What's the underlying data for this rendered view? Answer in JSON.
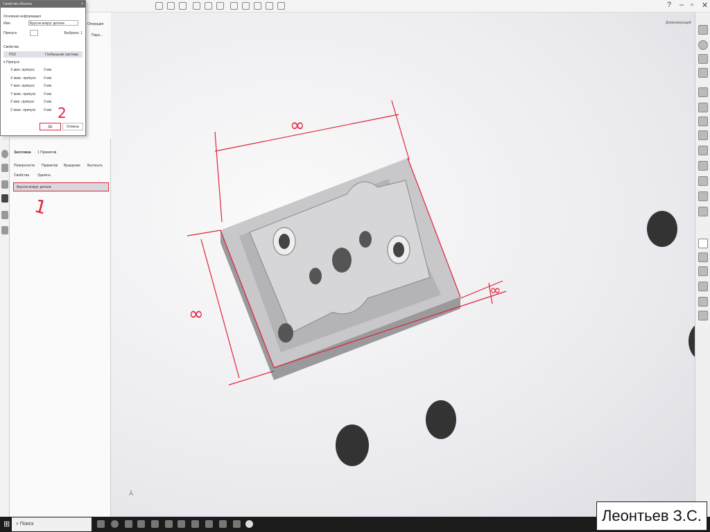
{
  "dialog": {
    "title": "Свойства объекта",
    "section_main": "Основная информация",
    "name_label": "Имя",
    "name_value": "Брусок вокруг детали",
    "allowance_label": "Припуск",
    "selected": "Выбрано: 1",
    "section_props": "Свойства",
    "csys_label": "ПСК",
    "csys_value": "Глобальная система",
    "allowance_group": "Припуск",
    "rows": [
      {
        "label": "X мин. припуск",
        "value": "0 мм"
      },
      {
        "label": "X макс. припуск",
        "value": "0 мм"
      },
      {
        "label": "Y мин. припуск",
        "value": "0 мм"
      },
      {
        "label": "Y макс. припуск",
        "value": "0 мм"
      },
      {
        "label": "Z мин. припуск",
        "value": "0 мм"
      },
      {
        "label": "Z макс. припуск",
        "value": "0 мм"
      }
    ],
    "ok": "Да",
    "cancel": "Отмена"
  },
  "bg_panel": {
    "operation": "Операция",
    "params": "Пара..."
  },
  "panel": {
    "title": "Заготовка",
    "count": "1 Примитив",
    "tools": [
      "Поверхности",
      "Примитив",
      "Вращение",
      "Вытянуть"
    ],
    "props": "Свойства",
    "delete": "Удалить",
    "item": "Брусок вокруг детали"
  },
  "view_mode": "Доминирующий",
  "annotations": {
    "one": "1",
    "two": "2",
    "inf": "∞"
  },
  "taskbar": {
    "search": "Поиск"
  },
  "caption": "Леонтьев З.С.",
  "colors": {
    "accent": "#e0223a"
  }
}
